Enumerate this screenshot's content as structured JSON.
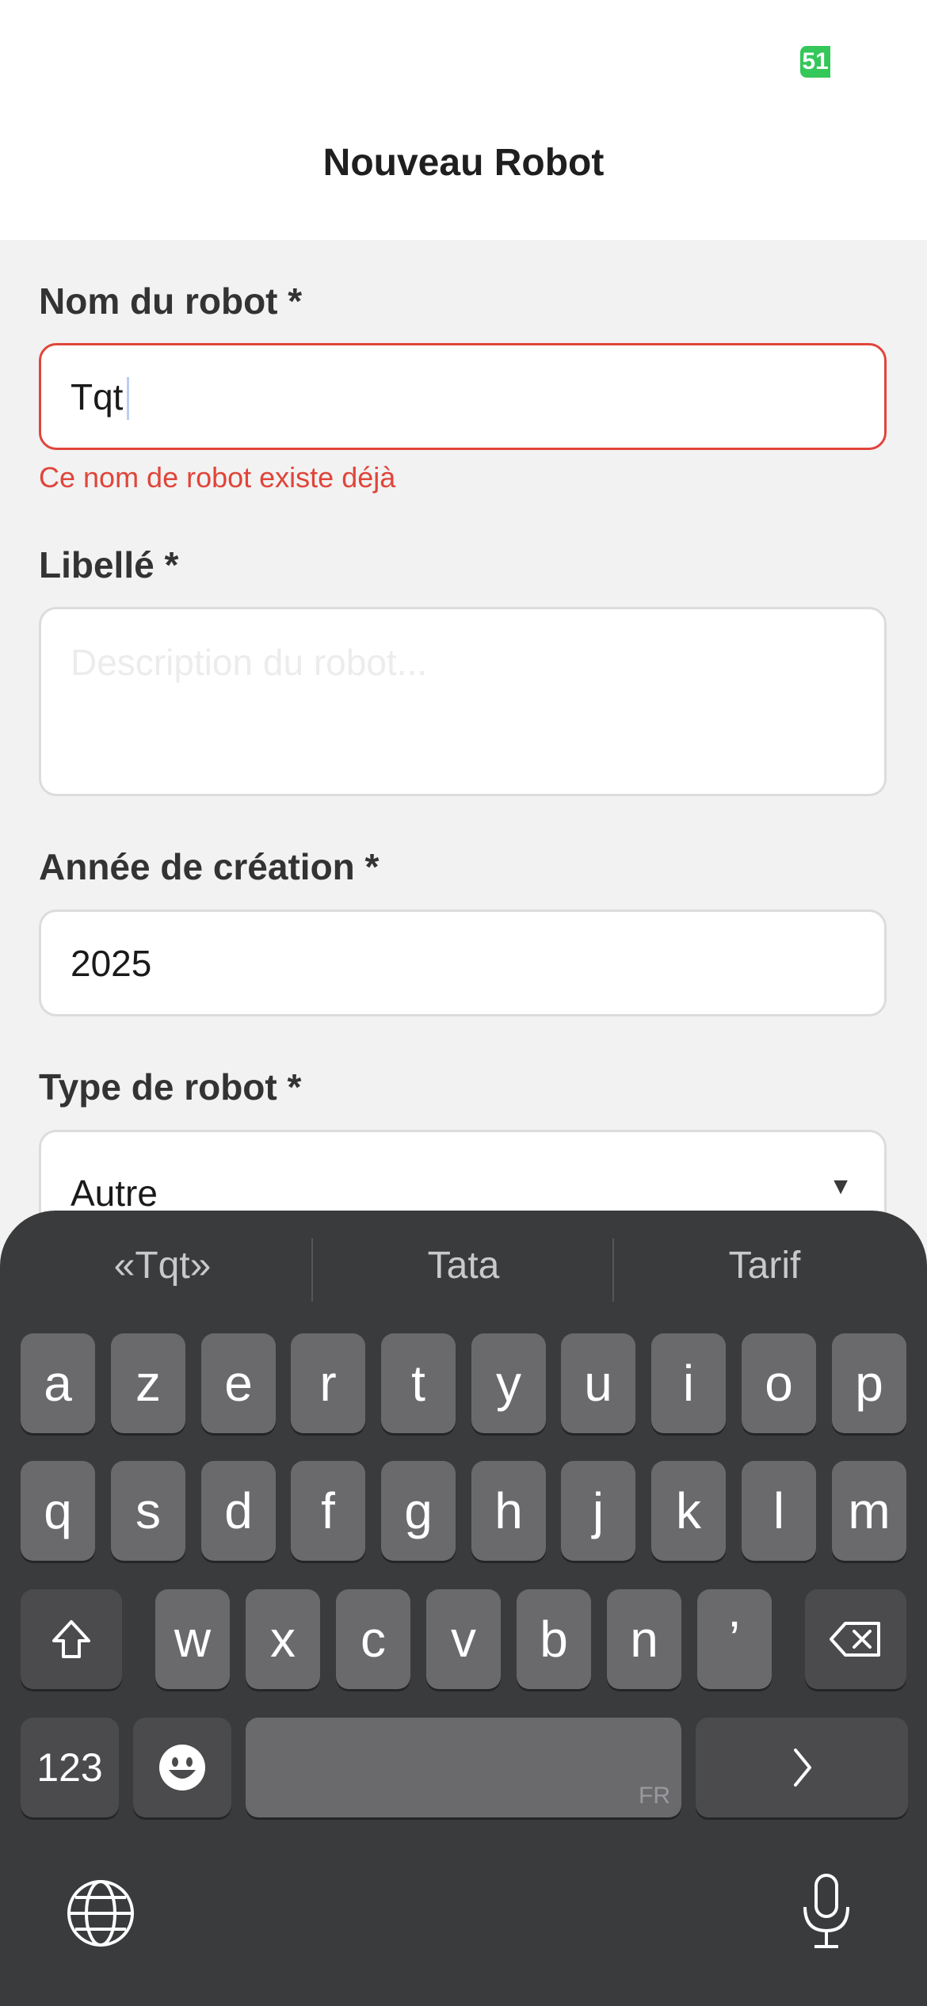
{
  "status": {
    "badge": "51"
  },
  "header": {
    "title": "Nouveau Robot"
  },
  "form": {
    "name": {
      "label": "Nom du robot *",
      "value": "Tqt",
      "error": "Ce nom de robot existe déjà"
    },
    "label_field": {
      "label": "Libellé *",
      "placeholder": "Description du robot..."
    },
    "year": {
      "label": "Année de création *",
      "value": "2025"
    },
    "type": {
      "label": "Type de robot *",
      "value": "Autre"
    }
  },
  "keyboard": {
    "suggestions": [
      "«Tqt»",
      "Tata",
      "Tarif"
    ],
    "row1": [
      "a",
      "z",
      "e",
      "r",
      "t",
      "y",
      "u",
      "i",
      "o",
      "p"
    ],
    "row2": [
      "q",
      "s",
      "d",
      "f",
      "g",
      "h",
      "j",
      "k",
      "l",
      "m"
    ],
    "row3": [
      "w",
      "x",
      "c",
      "v",
      "b",
      "n",
      "’"
    ],
    "numbers_key": "123",
    "space_lang": "FR"
  },
  "colors": {
    "error": "#e0453a",
    "badge": "#34c759",
    "keyboard_bg": "#3a3b3d",
    "key_bg": "#6a6a6d"
  }
}
